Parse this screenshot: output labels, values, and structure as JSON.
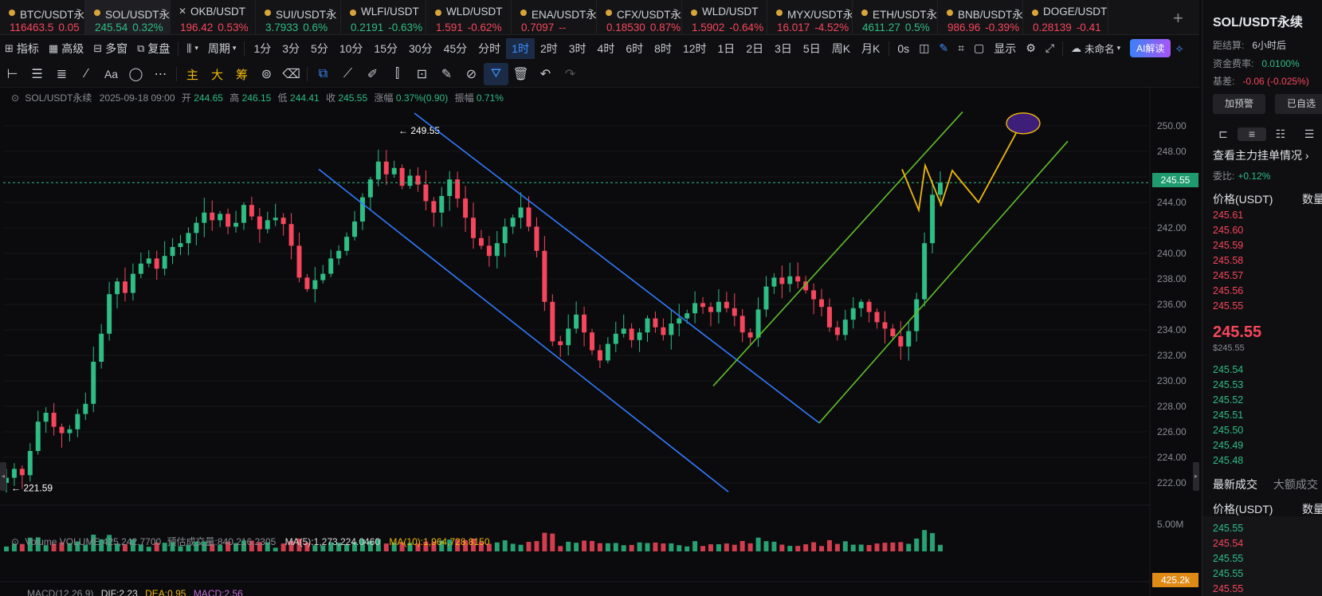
{
  "tickers": [
    {
      "symbol": "BTC/USDT永",
      "price": "116463.5",
      "change": "0.05",
      "dir": "dn",
      "mark": "dot"
    },
    {
      "symbol": "SOL/USDT永续",
      "price": "245.54",
      "change": "0.32%",
      "dir": "up",
      "mark": "dot",
      "active": true
    },
    {
      "symbol": "OKB/USDT",
      "price": "196.42",
      "change": "0.53%",
      "dir": "dn",
      "mark": "x"
    },
    {
      "symbol": "SUI/USDT永",
      "price": "3.7933",
      "change": "0.6%",
      "dir": "up",
      "mark": "dot"
    },
    {
      "symbol": "WLFI/USDT",
      "price": "0.2191",
      "change": "-0.63%",
      "dir": "up",
      "mark": "dot"
    },
    {
      "symbol": "WLD/USDT",
      "price": "1.591",
      "change": "-0.62%",
      "dir": "dn",
      "mark": "dot"
    },
    {
      "symbol": "ENA/USDT永",
      "price": "0.7097",
      "change": "--",
      "dir": "dn",
      "mark": "dot"
    },
    {
      "symbol": "CFX/USDT永",
      "price": "0.18530",
      "change": "0.87%",
      "dir": "dn",
      "mark": "dot"
    },
    {
      "symbol": "WLD/USDT",
      "price": "1.5902",
      "change": "-0.64%",
      "dir": "dn",
      "mark": "dot"
    },
    {
      "symbol": "MYX/USDT永",
      "price": "16.017",
      "change": "-4.52%",
      "dir": "dn",
      "mark": "dot"
    },
    {
      "symbol": "ETH/USDT永",
      "price": "4611.27",
      "change": "0.5%",
      "dir": "up",
      "mark": "dot"
    },
    {
      "symbol": "BNB/USDT永",
      "price": "986.96",
      "change": "-0.39%",
      "dir": "dn",
      "mark": "dot"
    },
    {
      "symbol": "DOGE/USDT",
      "price": "0.28139",
      "change": "-0.41",
      "dir": "dn",
      "mark": "dot"
    }
  ],
  "add_tab_label": "+",
  "toolbar1": {
    "indicators": "指标",
    "advanced": "高级",
    "multi_window": "多窗",
    "replay": "复盘",
    "period": "周期",
    "periods": [
      "1分",
      "3分",
      "5分",
      "10分",
      "15分",
      "30分",
      "45分",
      "分时",
      "1时",
      "2时",
      "3时",
      "4时",
      "6时",
      "8时",
      "12时",
      "1日",
      "2日",
      "3日",
      "5日",
      "周K",
      "月K"
    ],
    "selected_period": "1时",
    "seconds": "0s",
    "display": "显示",
    "unnamed": "未命名",
    "ai": "AI解读"
  },
  "toolbar2": {
    "main": "主",
    "large": "大",
    "chip": "筹"
  },
  "info": {
    "symbol": "SOL/USDT永续",
    "datetime": "2025-09-18 09:00",
    "open_label": "开",
    "open": "244.65",
    "high_label": "高",
    "high": "246.15",
    "low_label": "低",
    "low": "244.41",
    "close_label": "收",
    "close": "245.55",
    "chg_label": "涨幅",
    "chg": "0.37%(0.90)",
    "amp_label": "振幅",
    "amp": "0.71%"
  },
  "chart_data": {
    "type": "candlestick",
    "y_axis_ticks": [
      "250.00",
      "248.00",
      "246.00",
      "244.00",
      "242.00",
      "240.00",
      "238.00",
      "236.00",
      "234.00",
      "232.00",
      "230.00",
      "228.00",
      "226.00",
      "224.00",
      "222.00"
    ],
    "ylim": [
      221,
      251
    ],
    "high_marker": "249.55",
    "low_marker": "221.59",
    "last_price": "245.55",
    "close_path": [
      222.4,
      223.1,
      222.6,
      224.5,
      226.8,
      227.5,
      226.4,
      225.9,
      226.2,
      227.4,
      228.2,
      231.5,
      233.7,
      236.8,
      237.8,
      236.9,
      238.4,
      239.2,
      239.6,
      238.8,
      239.8,
      240.5,
      240.8,
      241.6,
      242.4,
      243.2,
      242.6,
      243.1,
      242.1,
      242.4,
      243.8,
      242.9,
      241.9,
      242.6,
      242.8,
      242.3,
      240.6,
      238.1,
      237.2,
      237.9,
      238.4,
      239.6,
      240.2,
      241.3,
      242.5,
      244.4,
      245.8,
      247.2,
      246.2,
      246.7,
      245.3,
      246.1,
      245.4,
      244.1,
      243.2,
      244.5,
      245.8,
      244.3,
      242.8,
      241.2,
      240.6,
      239.8,
      240.8,
      242.1,
      242.8,
      243.6,
      242.1,
      240.2,
      236.2,
      233.1,
      232.8,
      234.1,
      235.2,
      233.8,
      232.4,
      231.6,
      232.9,
      233.7,
      234.1,
      233.2,
      233.8,
      234.9,
      234.2,
      233.6,
      234.5,
      234.9,
      235.3,
      236.1,
      235.8,
      235.4,
      236.2,
      235.7,
      235.1,
      233.8,
      233.4,
      235.6,
      237.4,
      238.1,
      237.6,
      238.2,
      237.8,
      237.1,
      236.4,
      235.8,
      234.2,
      233.6,
      234.8,
      235.7,
      236.2,
      235.4,
      234.6,
      234.1,
      233.5,
      232.7,
      233.9,
      236.4,
      240.8,
      244.6,
      245.55
    ],
    "volume_ylim_label": "5.00M",
    "volume_current": "425.2k",
    "channels": [
      "descending channel (blue)",
      "ascending channel (green)",
      "projected zigzag (yellow)",
      "target ellipse (purple)"
    ]
  },
  "volume": {
    "label": "Volume",
    "volume": "VOLUME:425,242.7700",
    "est": "预估成交量:840,216.2305",
    "ma5": "MA(5):1,273,224.0460",
    "ma10": "MA(10):1,964,728.8150"
  },
  "macd": {
    "label": "MACD(12,26,9)",
    "dif": "DIF:2.23",
    "dea": "DEA:0.95",
    "macd": "MACD:2.56"
  },
  "rightpanel": {
    "title": "SOL/USDT永续",
    "countdown_label": "距结算:",
    "countdown": "6小时后",
    "funding_label": "资金费率:",
    "funding": "0.0100%",
    "basis_label": "基差:",
    "basis": "-0.06 (-0.025%)",
    "alert_btn": "加预警",
    "selected_btn": "已自选",
    "orders_link": "查看主力挂单情况",
    "ratio_label": "委比:",
    "ratio": "+0.12%",
    "price_head": "价格(USDT)",
    "qty_head": "数量",
    "asks": [
      "245.61",
      "245.60",
      "245.59",
      "245.58",
      "245.57",
      "245.56",
      "245.55"
    ],
    "last": "245.55",
    "last_sub": "$245.55",
    "bids": [
      "245.54",
      "245.53",
      "245.52",
      "245.51",
      "245.50",
      "245.49",
      "245.48"
    ],
    "trades_tab": "最新成交",
    "big_tab": "大额成交",
    "trades_price_head": "价格(USDT)",
    "trades_qty_head": "数量",
    "trades": [
      {
        "p": "245.55",
        "dir": "up"
      },
      {
        "p": "245.54",
        "dir": "dn"
      },
      {
        "p": "245.55",
        "dir": "up"
      },
      {
        "p": "245.55",
        "dir": "up"
      },
      {
        "p": "245.55",
        "dir": "dn"
      }
    ]
  }
}
